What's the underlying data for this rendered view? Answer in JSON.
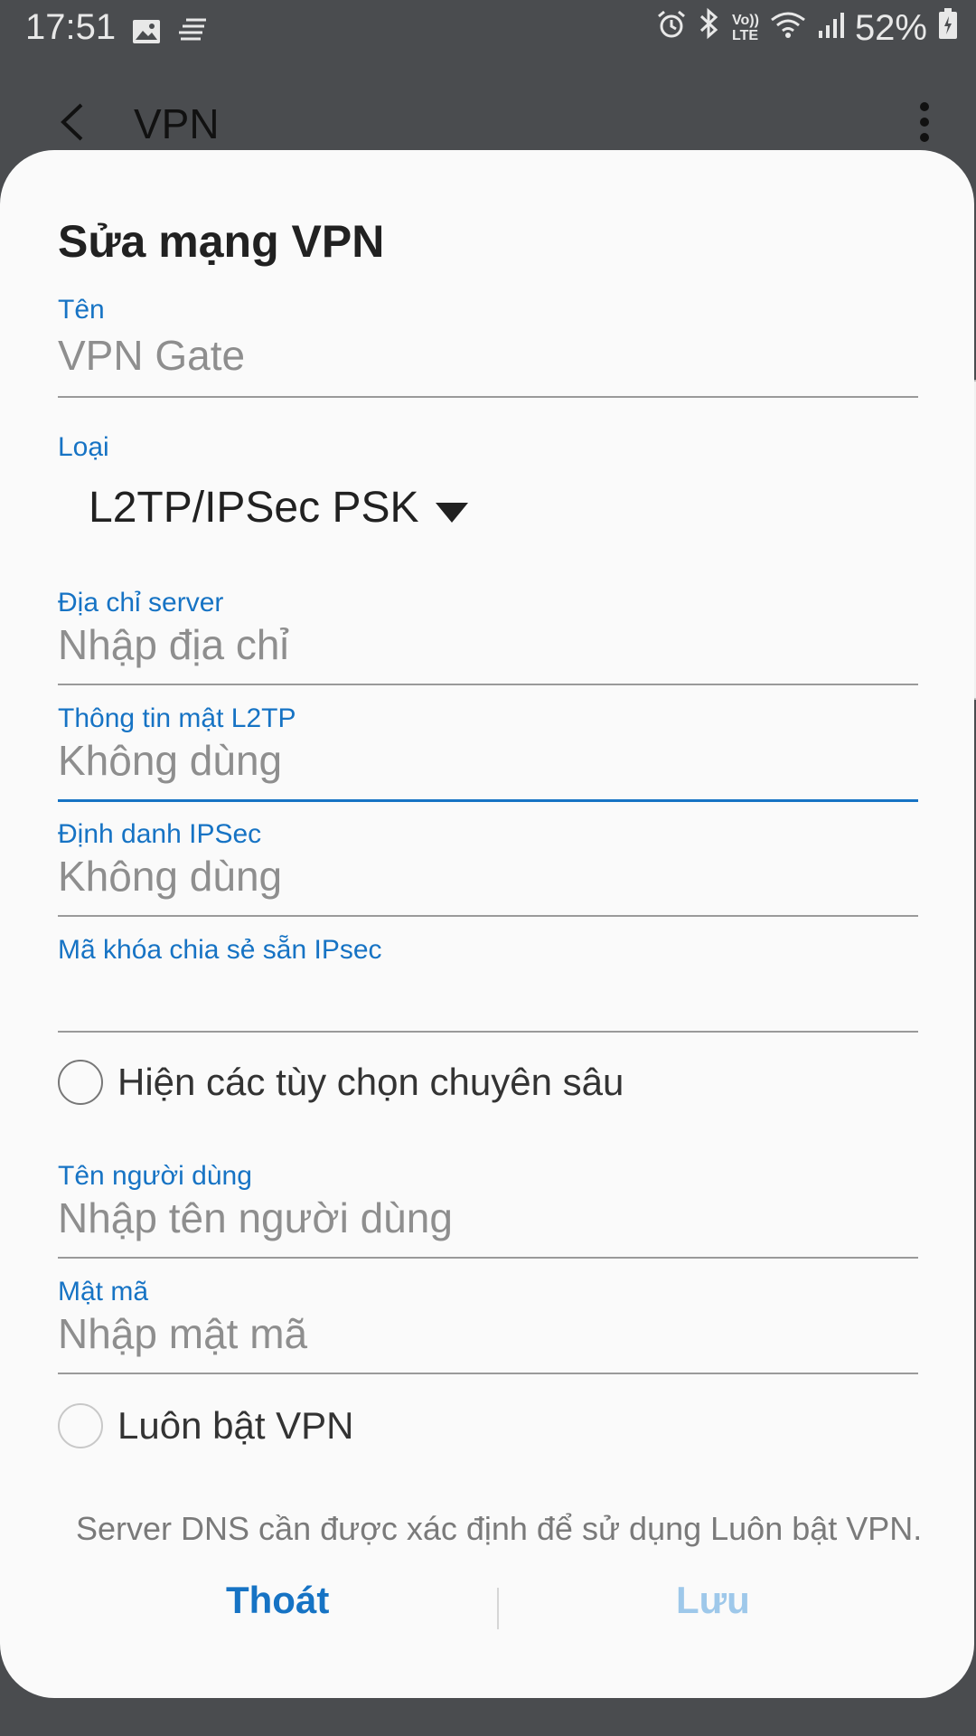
{
  "status_bar": {
    "time": "17:51",
    "battery": "52%",
    "icons": [
      "image-icon",
      "notification-icon",
      "alarm-icon",
      "bluetooth-icon",
      "volte-icon",
      "wifi-icon",
      "signal-icon",
      "battery-icon"
    ],
    "volte_top": "Vo))",
    "volte_bottom": "LTE"
  },
  "app_bar": {
    "title": "VPN"
  },
  "dialog": {
    "title": "Sửa mạng VPN",
    "fields": [
      {
        "label": "Tên",
        "value": "VPN Gate"
      },
      {
        "label": "Loại",
        "value": "L2TP/IPSec PSK"
      },
      {
        "label": "Địa chỉ server",
        "value": "Nhập địa chỉ"
      },
      {
        "label": "Thông tin mật L2TP",
        "value": "Không dùng"
      },
      {
        "label": "Định danh IPSec",
        "value": "Không dùng"
      },
      {
        "label": "Mã khóa chia sẻ sẵn IPsec",
        "value": ""
      },
      {
        "label": "Tên người dùng",
        "value": "Nhập tên người dùng"
      },
      {
        "label": "Mật mã",
        "value": "Nhập mật mã"
      }
    ],
    "advanced_option": "Hiện các tùy chọn chuyên sâu",
    "always_on": "Luôn bật VPN",
    "note": "Server DNS cần được xác định để sử dụng Luôn bật VPN.",
    "cancel": "Thoát",
    "save": "Lưu"
  },
  "colors": {
    "accent": "#1673c4",
    "disabled_accent": "#9ec8ea",
    "scrim": "#4a4c4f"
  }
}
